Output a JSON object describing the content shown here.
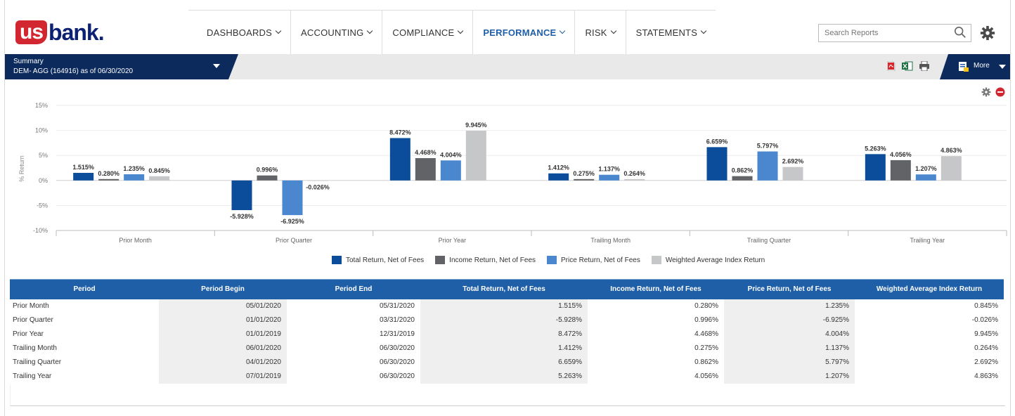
{
  "brand": {
    "part1": "us",
    "part2": "bank",
    "dot": "."
  },
  "nav": [
    {
      "label": "DASHBOARDS",
      "active": false
    },
    {
      "label": "ACCOUNTING",
      "active": false
    },
    {
      "label": "COMPLIANCE",
      "active": false
    },
    {
      "label": "PERFORMANCE",
      "active": true
    },
    {
      "label": "RISK",
      "active": false
    },
    {
      "label": "STATEMENTS",
      "active": false
    }
  ],
  "search": {
    "placeholder": "Search Reports"
  },
  "summary": {
    "title": "Summary",
    "account": "DEM- AGG (164916) as of 06/30/2020"
  },
  "toolbar": {
    "more_label": "More"
  },
  "colors": {
    "navy": "#0c2b5c",
    "total": "#0b4d9a",
    "income": "#616366",
    "price": "#4a87cf",
    "index": "#c6c7c9",
    "table_header": "#1f5fa8",
    "brand_red": "#d22630"
  },
  "icons": [
    "search-icon",
    "gear-icon",
    "pdf-icon",
    "excel-icon",
    "print-icon",
    "report-icon",
    "remove-icon"
  ],
  "chart_data": {
    "type": "bar",
    "title": "",
    "ylabel": "% Return",
    "ylim": [
      -10,
      15
    ],
    "yticks": [
      "15%",
      "10%",
      "5%",
      "0%",
      "-5%",
      "-10%"
    ],
    "categories": [
      "Prior Month",
      "Prior Quarter",
      "Prior Year",
      "Trailing Month",
      "Trailing Quarter",
      "Trailing Year"
    ],
    "legend_position": "bottom",
    "series": [
      {
        "name": "Total Return, Net of Fees",
        "values": [
          1.515,
          -5.928,
          8.472,
          1.412,
          6.659,
          5.263
        ],
        "labels": [
          "1.515%",
          "-5.928%",
          "8.472%",
          "1.412%",
          "6.659%",
          "5.263%"
        ]
      },
      {
        "name": "Income Return, Net of Fees",
        "values": [
          0.28,
          0.996,
          4.468,
          0.275,
          0.862,
          4.056
        ],
        "labels": [
          "0.280%",
          "0.996%",
          "4.468%",
          "0.275%",
          "0.862%",
          "4.056%"
        ]
      },
      {
        "name": "Price Return, Net of Fees",
        "values": [
          1.235,
          -6.925,
          4.004,
          1.137,
          5.797,
          1.207
        ],
        "labels": [
          "1.235%",
          "-6.925%",
          "4.004%",
          "1.137%",
          "5.797%",
          "1.207%"
        ]
      },
      {
        "name": "Weighted Average Index Return",
        "values": [
          0.845,
          -0.026,
          9.945,
          0.264,
          2.692,
          4.863
        ],
        "labels": [
          "0.845%",
          "-0.026%",
          "9.945%",
          "0.264%",
          "2.692%",
          "4.863%"
        ]
      }
    ]
  },
  "table": {
    "headers": [
      "Period",
      "Period Begin",
      "Period End",
      "Total Return, Net of Fees",
      "Income Return, Net of Fees",
      "Price Return, Net of Fees",
      "Weighted Average Index Return"
    ],
    "rows": [
      [
        "Prior Month",
        "05/01/2020",
        "05/31/2020",
        "1.515%",
        "0.280%",
        "1.235%",
        "0.845%"
      ],
      [
        "Prior Quarter",
        "01/01/2020",
        "03/31/2020",
        "-5.928%",
        "0.996%",
        "-6.925%",
        "-0.026%"
      ],
      [
        "Prior Year",
        "01/01/2019",
        "12/31/2019",
        "8.472%",
        "4.468%",
        "4.004%",
        "9.945%"
      ],
      [
        "Trailing Month",
        "06/01/2020",
        "06/30/2020",
        "1.412%",
        "0.275%",
        "1.137%",
        "0.264%"
      ],
      [
        "Trailing Quarter",
        "04/01/2020",
        "06/30/2020",
        "6.659%",
        "0.862%",
        "5.797%",
        "2.692%"
      ],
      [
        "Trailing Year",
        "07/01/2019",
        "06/30/2020",
        "5.263%",
        "4.056%",
        "1.207%",
        "4.863%"
      ]
    ]
  }
}
